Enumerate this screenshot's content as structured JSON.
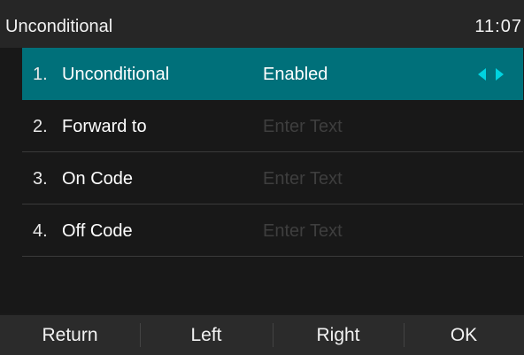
{
  "header": {
    "title": "Unconditional",
    "time": "11:07"
  },
  "items": [
    {
      "index": "1.",
      "label": "Unconditional",
      "value": "Enabled",
      "selected": true
    },
    {
      "index": "2.",
      "label": "Forward to",
      "placeholder": "Enter Text"
    },
    {
      "index": "3.",
      "label": "On Code",
      "placeholder": "Enter Text"
    },
    {
      "index": "4.",
      "label": "Off Code",
      "placeholder": "Enter Text"
    }
  ],
  "softkeys": {
    "return_label": "Return",
    "left_label": "Left",
    "right_label": "Right",
    "ok_label": "OK"
  },
  "colors": {
    "selection": "#00707a",
    "arrow_accent": "#00d3e0",
    "background": "#181818"
  }
}
